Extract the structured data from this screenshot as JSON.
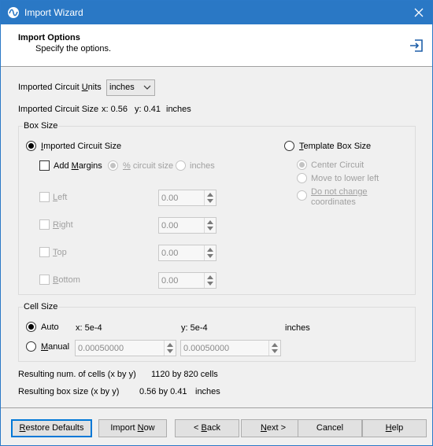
{
  "window": {
    "title": "Import Wizard"
  },
  "header": {
    "title": "Import Options",
    "subtitle": "Specify the options."
  },
  "units": {
    "label_pre": "Imported Circuit ",
    "label_u": "U",
    "label_post": "nits",
    "value": "inches"
  },
  "circuit_size": {
    "label": "Imported Circuit Size",
    "x": "x: 0.56",
    "y": "y: 0.41",
    "unit": "inches"
  },
  "box_size": {
    "legend": "Box Size",
    "imported_option": {
      "u": "I",
      "rest": "mported Circuit Size",
      "selected": true
    },
    "template_option": {
      "u": "T",
      "rest": "emplate Box Size",
      "selected": false
    },
    "add_margins": {
      "pre": "Add ",
      "u": "M",
      "post": "argins",
      "checked": false
    },
    "margin_pct": {
      "u": "%",
      "rest": " circuit size",
      "selected": true
    },
    "margin_inches": {
      "label": "inches",
      "selected": false
    },
    "template_center": {
      "label": "Center Circuit",
      "selected": true
    },
    "template_lowerleft": {
      "label": "Move to lower left",
      "selected": false
    },
    "template_nochange": {
      "line1": "Do not change",
      "line2": "coordinates",
      "selected": false
    },
    "margins": [
      {
        "u": "L",
        "rest": "eft",
        "value": "0.00"
      },
      {
        "u": "R",
        "rest": "ight",
        "value": "0.00"
      },
      {
        "u": "T",
        "rest": "op",
        "value": "0.00"
      },
      {
        "u": "B",
        "rest": "ottom",
        "value": "0.00"
      }
    ]
  },
  "cell_size": {
    "legend": "Cell Size",
    "auto": {
      "label": "Auto",
      "selected": true,
      "x": "x: 5e-4",
      "y": "y: 5e-4",
      "unit": "inches"
    },
    "manual": {
      "u": "M",
      "rest": "anual",
      "selected": false,
      "x_value": "0.00050000",
      "y_value": "0.00050000"
    }
  },
  "results": {
    "cells_label": "Resulting num. of cells (x by y)",
    "cells_value": "1120 by 820 cells",
    "box_label": "Resulting box size (x by y)",
    "box_value": "0.56 by 0.41",
    "box_unit": "inches"
  },
  "buttons": {
    "restore": {
      "u": "R",
      "rest": "estore Defaults"
    },
    "import_now": {
      "pre": "Import ",
      "u": "N",
      "rest": "ow"
    },
    "back": {
      "pre": "< ",
      "u": "B",
      "rest": "ack"
    },
    "next": {
      "u": "N",
      "rest": "ext >"
    },
    "cancel": "Cancel",
    "help": {
      "u": "H",
      "rest": "elp"
    }
  }
}
